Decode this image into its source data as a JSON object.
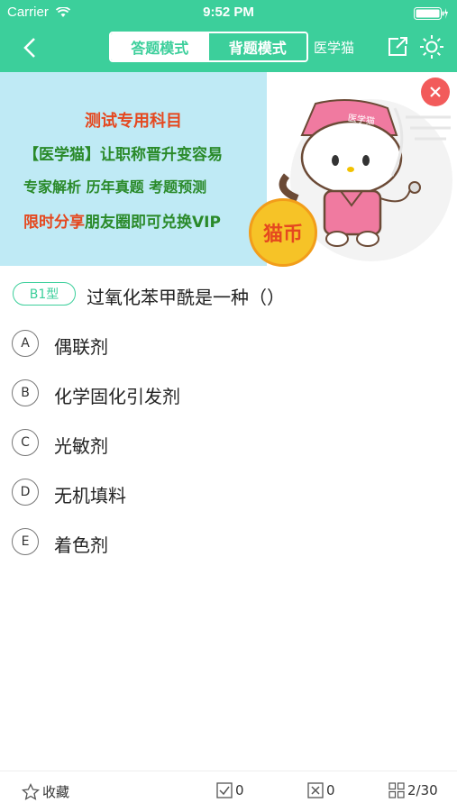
{
  "status_bar": {
    "carrier": "Carrier",
    "time": "9:52 PM"
  },
  "navbar": {
    "back_icon": "chevron-left-icon",
    "modes": [
      {
        "label": "答题模式",
        "selected": true
      },
      {
        "label": "背题模式",
        "selected": false
      }
    ],
    "brand": "医学猫",
    "share_icon": "share-icon",
    "settings_icon": "brightness-icon"
  },
  "banner": {
    "line1": "测试专用科目",
    "line2": "【医学猫】让职称晋升变容易",
    "line3": "专家解析 历年真题 考题预测",
    "line4_red": "限时分享",
    "line4_green": "朋友圈即可兑换VIP",
    "coin": "猫币",
    "cap_text": "医学猫",
    "close_icon": "close-icon"
  },
  "question": {
    "type": "B1型",
    "text": "过氧化苯甲酰是一种（）",
    "options": [
      {
        "letter": "A",
        "text": "偶联剂"
      },
      {
        "letter": "B",
        "text": "化学固化引发剂"
      },
      {
        "letter": "C",
        "text": "光敏剂"
      },
      {
        "letter": "D",
        "text": "无机填料"
      },
      {
        "letter": "E",
        "text": "着色剂"
      }
    ]
  },
  "footer": {
    "favorite": "收藏",
    "correct_count": "0",
    "wrong_count": "0",
    "progress": "2/30"
  },
  "colors": {
    "accent": "#3ccf9b",
    "banner_bg": "#bfeaf5",
    "red": "#e5481f",
    "green": "#2a8a2a",
    "coin": "#f6c327"
  }
}
